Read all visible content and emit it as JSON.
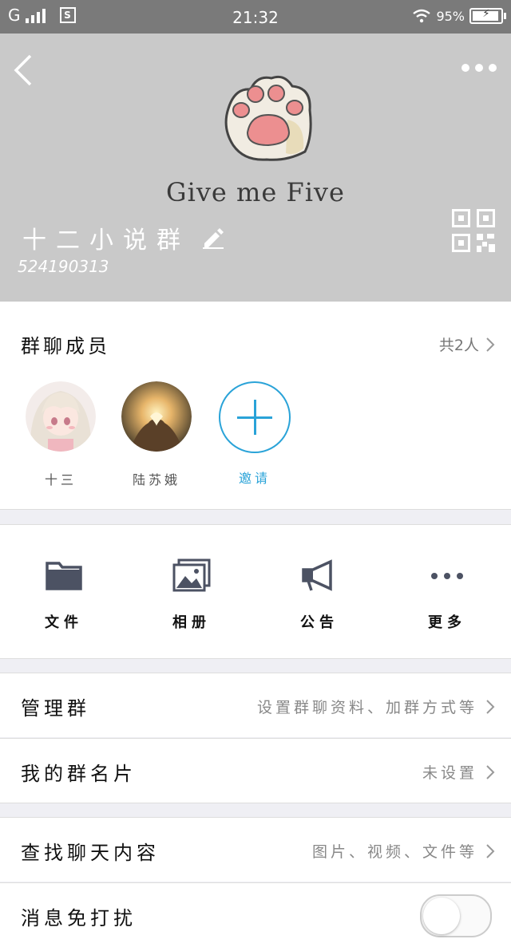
{
  "status_bar": {
    "carrier": "G",
    "sim_icon": "S",
    "time": "21:32",
    "battery": "95%",
    "battery_level": 0.95
  },
  "header": {
    "artwork_caption": "Give me Five",
    "group_name": "十二小说群",
    "group_id": "524190313",
    "icons": [
      "back-icon",
      "more-icon",
      "edit-pencil-icon",
      "qr-code-icon"
    ]
  },
  "members": {
    "title": "群聊成员",
    "count_label": "共2人",
    "list": [
      {
        "name": "十三"
      },
      {
        "name": "陆苏娥"
      }
    ],
    "invite_label": "邀请"
  },
  "tools": [
    {
      "label": "文件",
      "icon": "folder-icon"
    },
    {
      "label": "相册",
      "icon": "album-icon"
    },
    {
      "label": "公告",
      "icon": "megaphone-icon"
    },
    {
      "label": "更多",
      "icon": "more-dots-icon"
    }
  ],
  "settings": [
    {
      "label": "管理群",
      "value": "设置群聊资料、加群方式等"
    },
    {
      "label": "我的群名片",
      "value": "未设置"
    },
    {
      "label": "查找聊天内容",
      "value": "图片、视频、文件等"
    },
    {
      "label": "消息免打扰",
      "value": ""
    }
  ],
  "colors": {
    "accent": "#2aa3d8",
    "header_bg": "#c9c9c9",
    "statusbar_bg": "#7a7a7a"
  }
}
